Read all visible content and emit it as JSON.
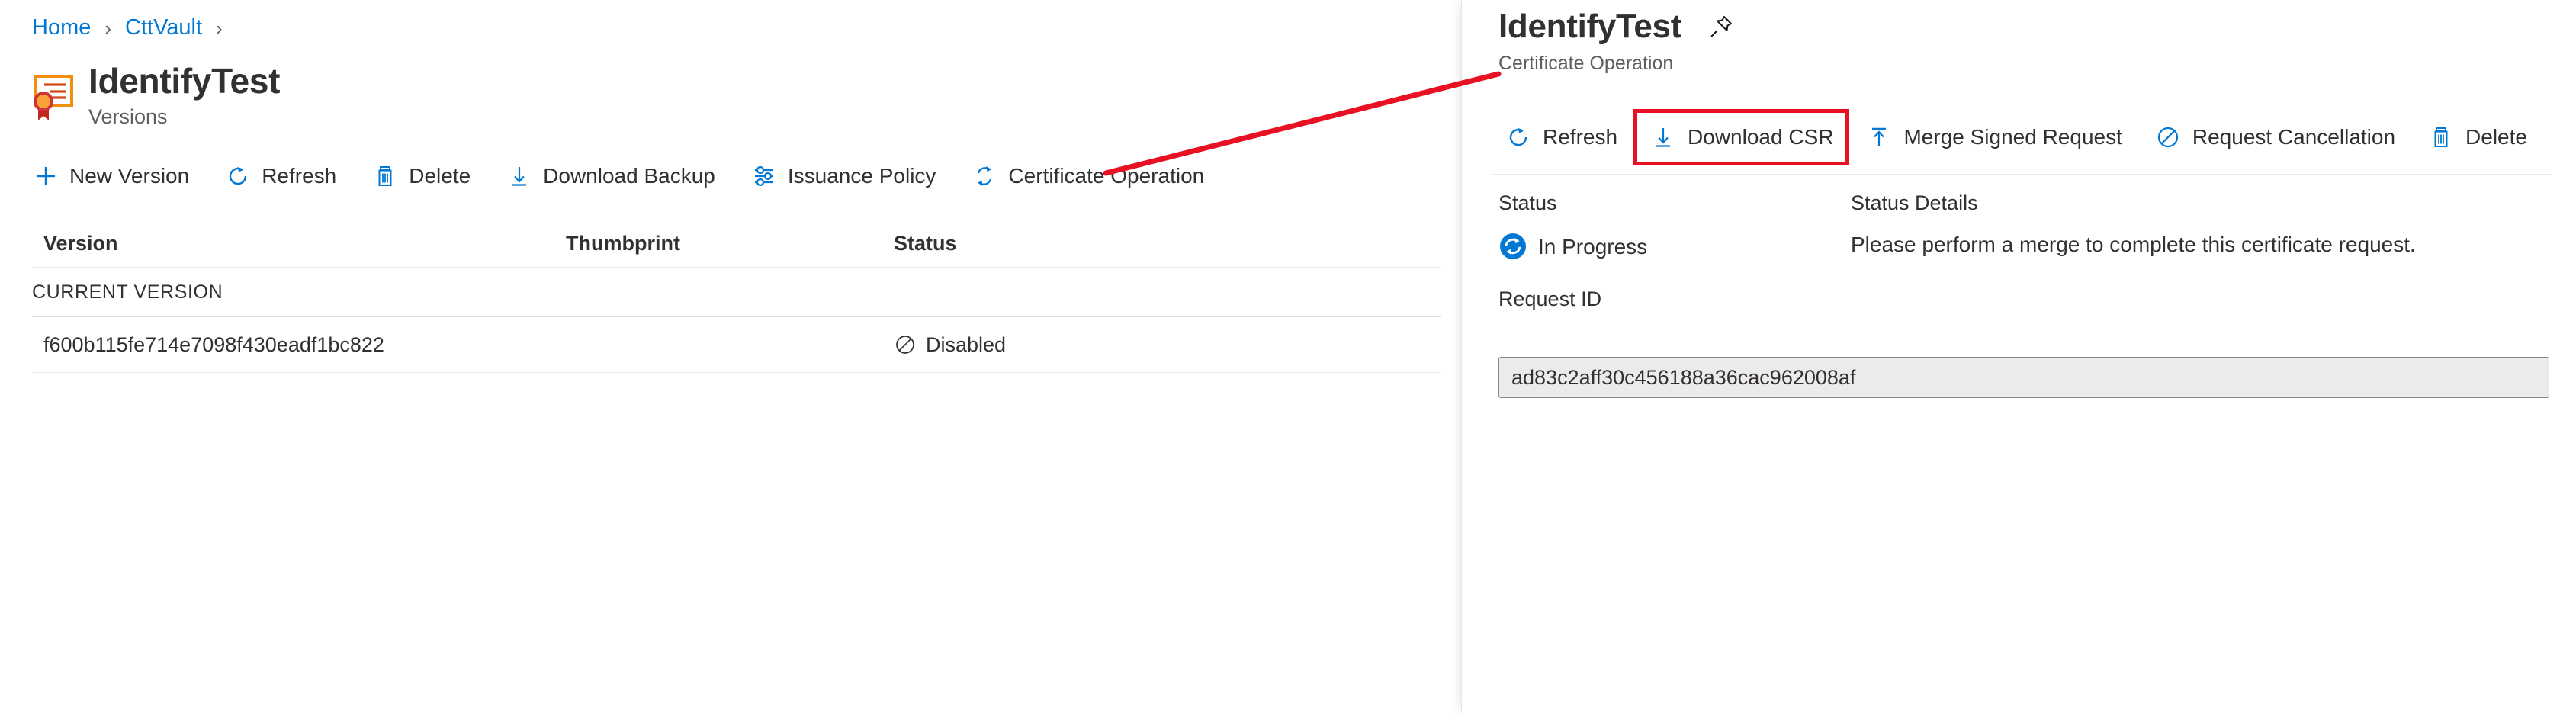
{
  "breadcrumb": {
    "items": [
      {
        "label": "Home",
        "link": true
      },
      {
        "label": "CttVault",
        "link": true
      }
    ],
    "separator": "›"
  },
  "header": {
    "title": "IdentifyTest",
    "subtitle": "Versions",
    "icon": "certificate-icon"
  },
  "toolbar": {
    "commands": [
      {
        "label": "New Version",
        "icon": "plus-icon"
      },
      {
        "label": "Refresh",
        "icon": "refresh-icon"
      },
      {
        "label": "Delete",
        "icon": "trash-icon"
      },
      {
        "label": "Download Backup",
        "icon": "download-icon"
      },
      {
        "label": "Issuance Policy",
        "icon": "sliders-icon"
      },
      {
        "label": "Certificate Operation",
        "icon": "sync-icon"
      }
    ]
  },
  "table": {
    "columns": [
      "Version",
      "Thumbprint",
      "Status"
    ],
    "groups": [
      {
        "label": "CURRENT VERSION",
        "rows": [
          {
            "version": "f600b115fe714e7098f430eadf1bc822",
            "thumbprint": "",
            "status": "Disabled",
            "status_icon": "blocked-icon"
          }
        ]
      }
    ]
  },
  "detail_panel": {
    "title": "IdentifyTest",
    "subtitle": "Certificate Operation",
    "pin_icon": "pin-icon",
    "commands": [
      {
        "label": "Refresh",
        "icon": "refresh-icon",
        "highlighted": false
      },
      {
        "label": "Download CSR",
        "icon": "download-icon",
        "highlighted": true
      },
      {
        "label": "Merge Signed Request",
        "icon": "upload-icon",
        "highlighted": false
      },
      {
        "label": "Request Cancellation",
        "icon": "blocked-icon",
        "highlighted": false
      },
      {
        "label": "Delete",
        "icon": "trash-icon",
        "highlighted": false
      }
    ],
    "status_label": "Status",
    "status_value": "In Progress",
    "status_icon": "in-progress-icon",
    "status_details_label": "Status Details",
    "status_details_value": "Please perform a merge to complete this certificate request.",
    "request_id_label": "Request ID",
    "request_id_value": "ad83c2aff30c456188a36cac962008af"
  },
  "annotation": {
    "highlight_color": "#e81123",
    "arrow_color": "#e81123",
    "description": "red line pointing from Certificate Operation command to panel subtitle"
  },
  "colors": {
    "accent_blue": "#0078d4",
    "link_blue": "#0078d4",
    "text_primary": "#323130",
    "text_secondary": "#605e5c",
    "divider": "#edebe9",
    "readonly_bg": "#edebe9",
    "cert_icon_orange": "#f2900d",
    "cert_icon_red": "#d13438"
  }
}
